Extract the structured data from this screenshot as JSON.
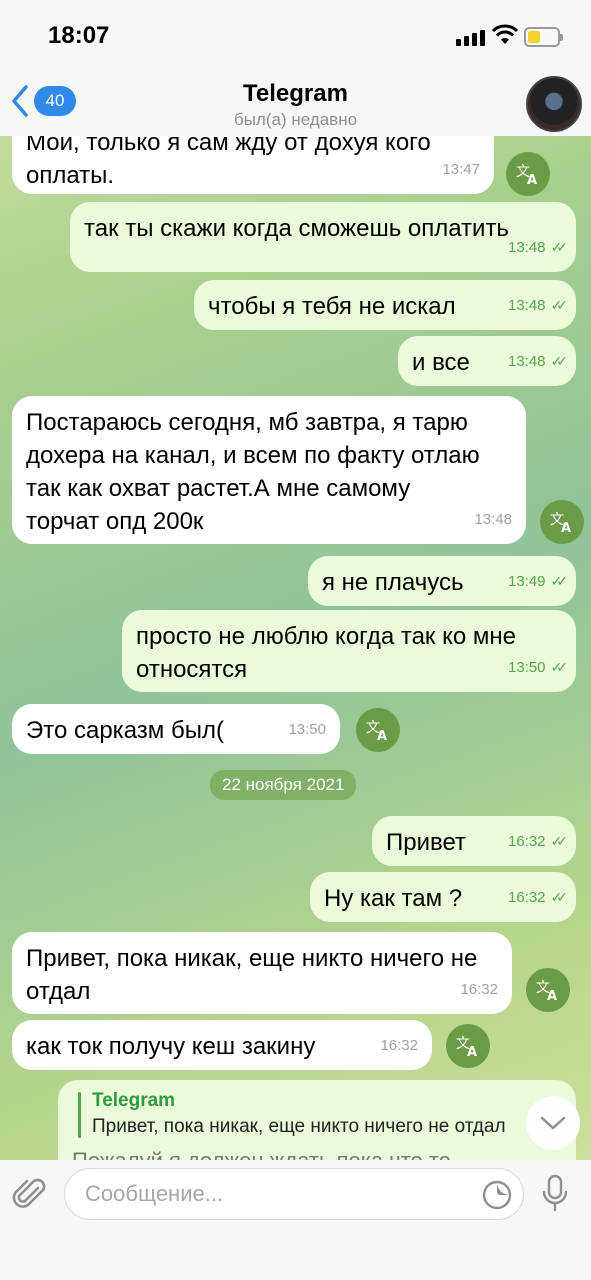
{
  "status": {
    "time": "18:07"
  },
  "header": {
    "back_count": "40",
    "title": "Telegram",
    "subtitle": "был(а) недавно"
  },
  "messages": [
    {
      "text_top": "Мои, только я сам жду от дохуя кого",
      "text": "оплаты.",
      "time": "13:47"
    },
    {
      "text": "так ты скажи когда сможешь оплатить",
      "time": "13:48"
    },
    {
      "text": "чтобы я тебя не искал",
      "time": "13:48"
    },
    {
      "text": "и все",
      "time": "13:48"
    },
    {
      "text": "Постараюсь сегодня, мб завтра, я тарю дохера на канал, и всем по факту отлаю так как охват растет.А мне самому торчат опд 200к",
      "time": "13:48"
    },
    {
      "text": "я не плачусь",
      "time": "13:49"
    },
    {
      "text": "просто не люблю когда так ко мне относятся",
      "time": "13:50"
    },
    {
      "text": "Это сарказм был(",
      "time": "13:50"
    },
    {
      "text": "Привет",
      "time": "16:32"
    },
    {
      "text": "Ну как там ?",
      "time": "16:32"
    },
    {
      "text": "Привет, пока никак, еще никто ничего не отдал",
      "time": "16:32"
    },
    {
      "text": "как ток получу кеш закину",
      "time": "16:32"
    }
  ],
  "date_separator": "22 ноября 2021",
  "reply": {
    "name": "Telegram",
    "quote": "Привет, пока никак, еще никто ничего не отдал",
    "cut_text": "Пожалуй я должен ждать пока что то"
  },
  "input": {
    "placeholder": "Сообщение..."
  },
  "colors": {
    "accent": "#2f8ae8",
    "outgoing": "#eafadb",
    "check": "#56a74a",
    "translate": "#6a9c46"
  },
  "icons": [
    "translate-icon",
    "attach-icon",
    "sticker-icon",
    "mic-icon",
    "chevron-down-icon",
    "back-chevron-icon"
  ]
}
